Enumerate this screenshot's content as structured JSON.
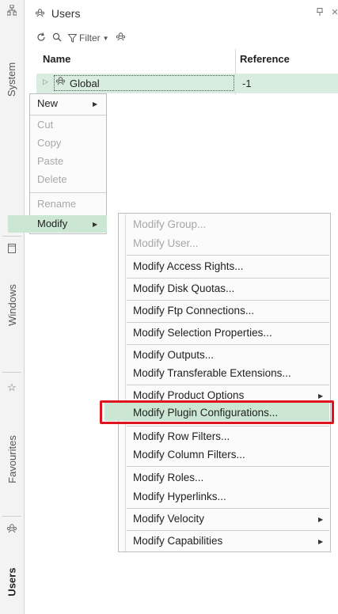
{
  "sidebar": {
    "tabs": [
      {
        "label": "System"
      },
      {
        "label": "Windows"
      },
      {
        "label": "Favourites"
      },
      {
        "label": "Users"
      }
    ],
    "icons": [
      "sitemap-icon",
      "window-icon",
      "star-icon",
      "users-icon"
    ]
  },
  "panel": {
    "title": "Users",
    "pin_glyph": "ᵖ"
  },
  "toolbar": {
    "filter_label": "Filter"
  },
  "grid": {
    "columns": [
      "Name",
      "Reference"
    ],
    "rows": [
      {
        "name": "Global",
        "reference": "-1",
        "selected": true
      }
    ]
  },
  "context_menu": {
    "items": [
      {
        "label": "New",
        "enabled": true,
        "submenu": true
      },
      {
        "label": "Cut",
        "enabled": false
      },
      {
        "label": "Copy",
        "enabled": false
      },
      {
        "label": "Paste",
        "enabled": false
      },
      {
        "label": "Delete",
        "enabled": false
      },
      {
        "label": "Rename",
        "enabled": false
      },
      {
        "label": "Modify",
        "enabled": true,
        "submenu": true,
        "highlighted": true
      }
    ]
  },
  "submenu": {
    "items": [
      {
        "label": "Modify Group...",
        "enabled": false
      },
      {
        "label": "Modify User...",
        "enabled": false
      },
      {
        "label": "Modify Access Rights...",
        "enabled": true
      },
      {
        "label": "Modify Disk Quotas...",
        "enabled": true
      },
      {
        "label": "Modify Ftp Connections...",
        "enabled": true
      },
      {
        "label": "Modify Selection Properties...",
        "enabled": true
      },
      {
        "label": "Modify Outputs...",
        "enabled": true
      },
      {
        "label": "Modify Transferable Extensions...",
        "enabled": true
      },
      {
        "label": "Modify Product Options",
        "enabled": true,
        "submenu": true
      },
      {
        "label": "Modify Plugin Configurations...",
        "enabled": true,
        "highlighted": true
      },
      {
        "label": "Modify Row Filters...",
        "enabled": true
      },
      {
        "label": "Modify Column Filters...",
        "enabled": true
      },
      {
        "label": "Modify Roles...",
        "enabled": true
      },
      {
        "label": "Modify Hyperlinks...",
        "enabled": true
      },
      {
        "label": "Modify Velocity",
        "enabled": true,
        "submenu": true
      },
      {
        "label": "Modify Capabilities",
        "enabled": true,
        "submenu": true
      }
    ]
  },
  "colors": {
    "selection": "#cbe6d3",
    "row_selected": "#d8ece0",
    "highlight_box": "#e0141e",
    "disabled_text": "#a8a8a8"
  }
}
